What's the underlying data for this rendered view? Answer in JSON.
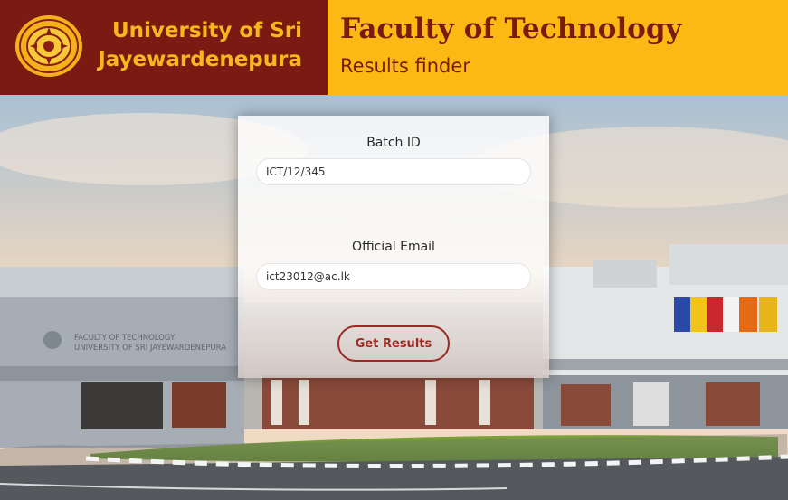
{
  "header": {
    "university_line1": "University of Sri",
    "university_line2": "Jayewardenepura",
    "faculty_title": "Faculty of Technology",
    "faculty_subtitle": "Results finder"
  },
  "building_sign": {
    "line1": "FACULTY OF TECHNOLOGY",
    "line2": "UNIVERSITY OF SRI JAYEWARDENEPURA"
  },
  "form": {
    "batch_label": "Batch ID",
    "batch_value": "ICT/12/345",
    "email_label": "Official Email",
    "email_value": "ict23012@ac.lk",
    "submit_label": "Get Results"
  },
  "colors": {
    "maroon": "#7b1a13",
    "gold": "#fdb913"
  }
}
